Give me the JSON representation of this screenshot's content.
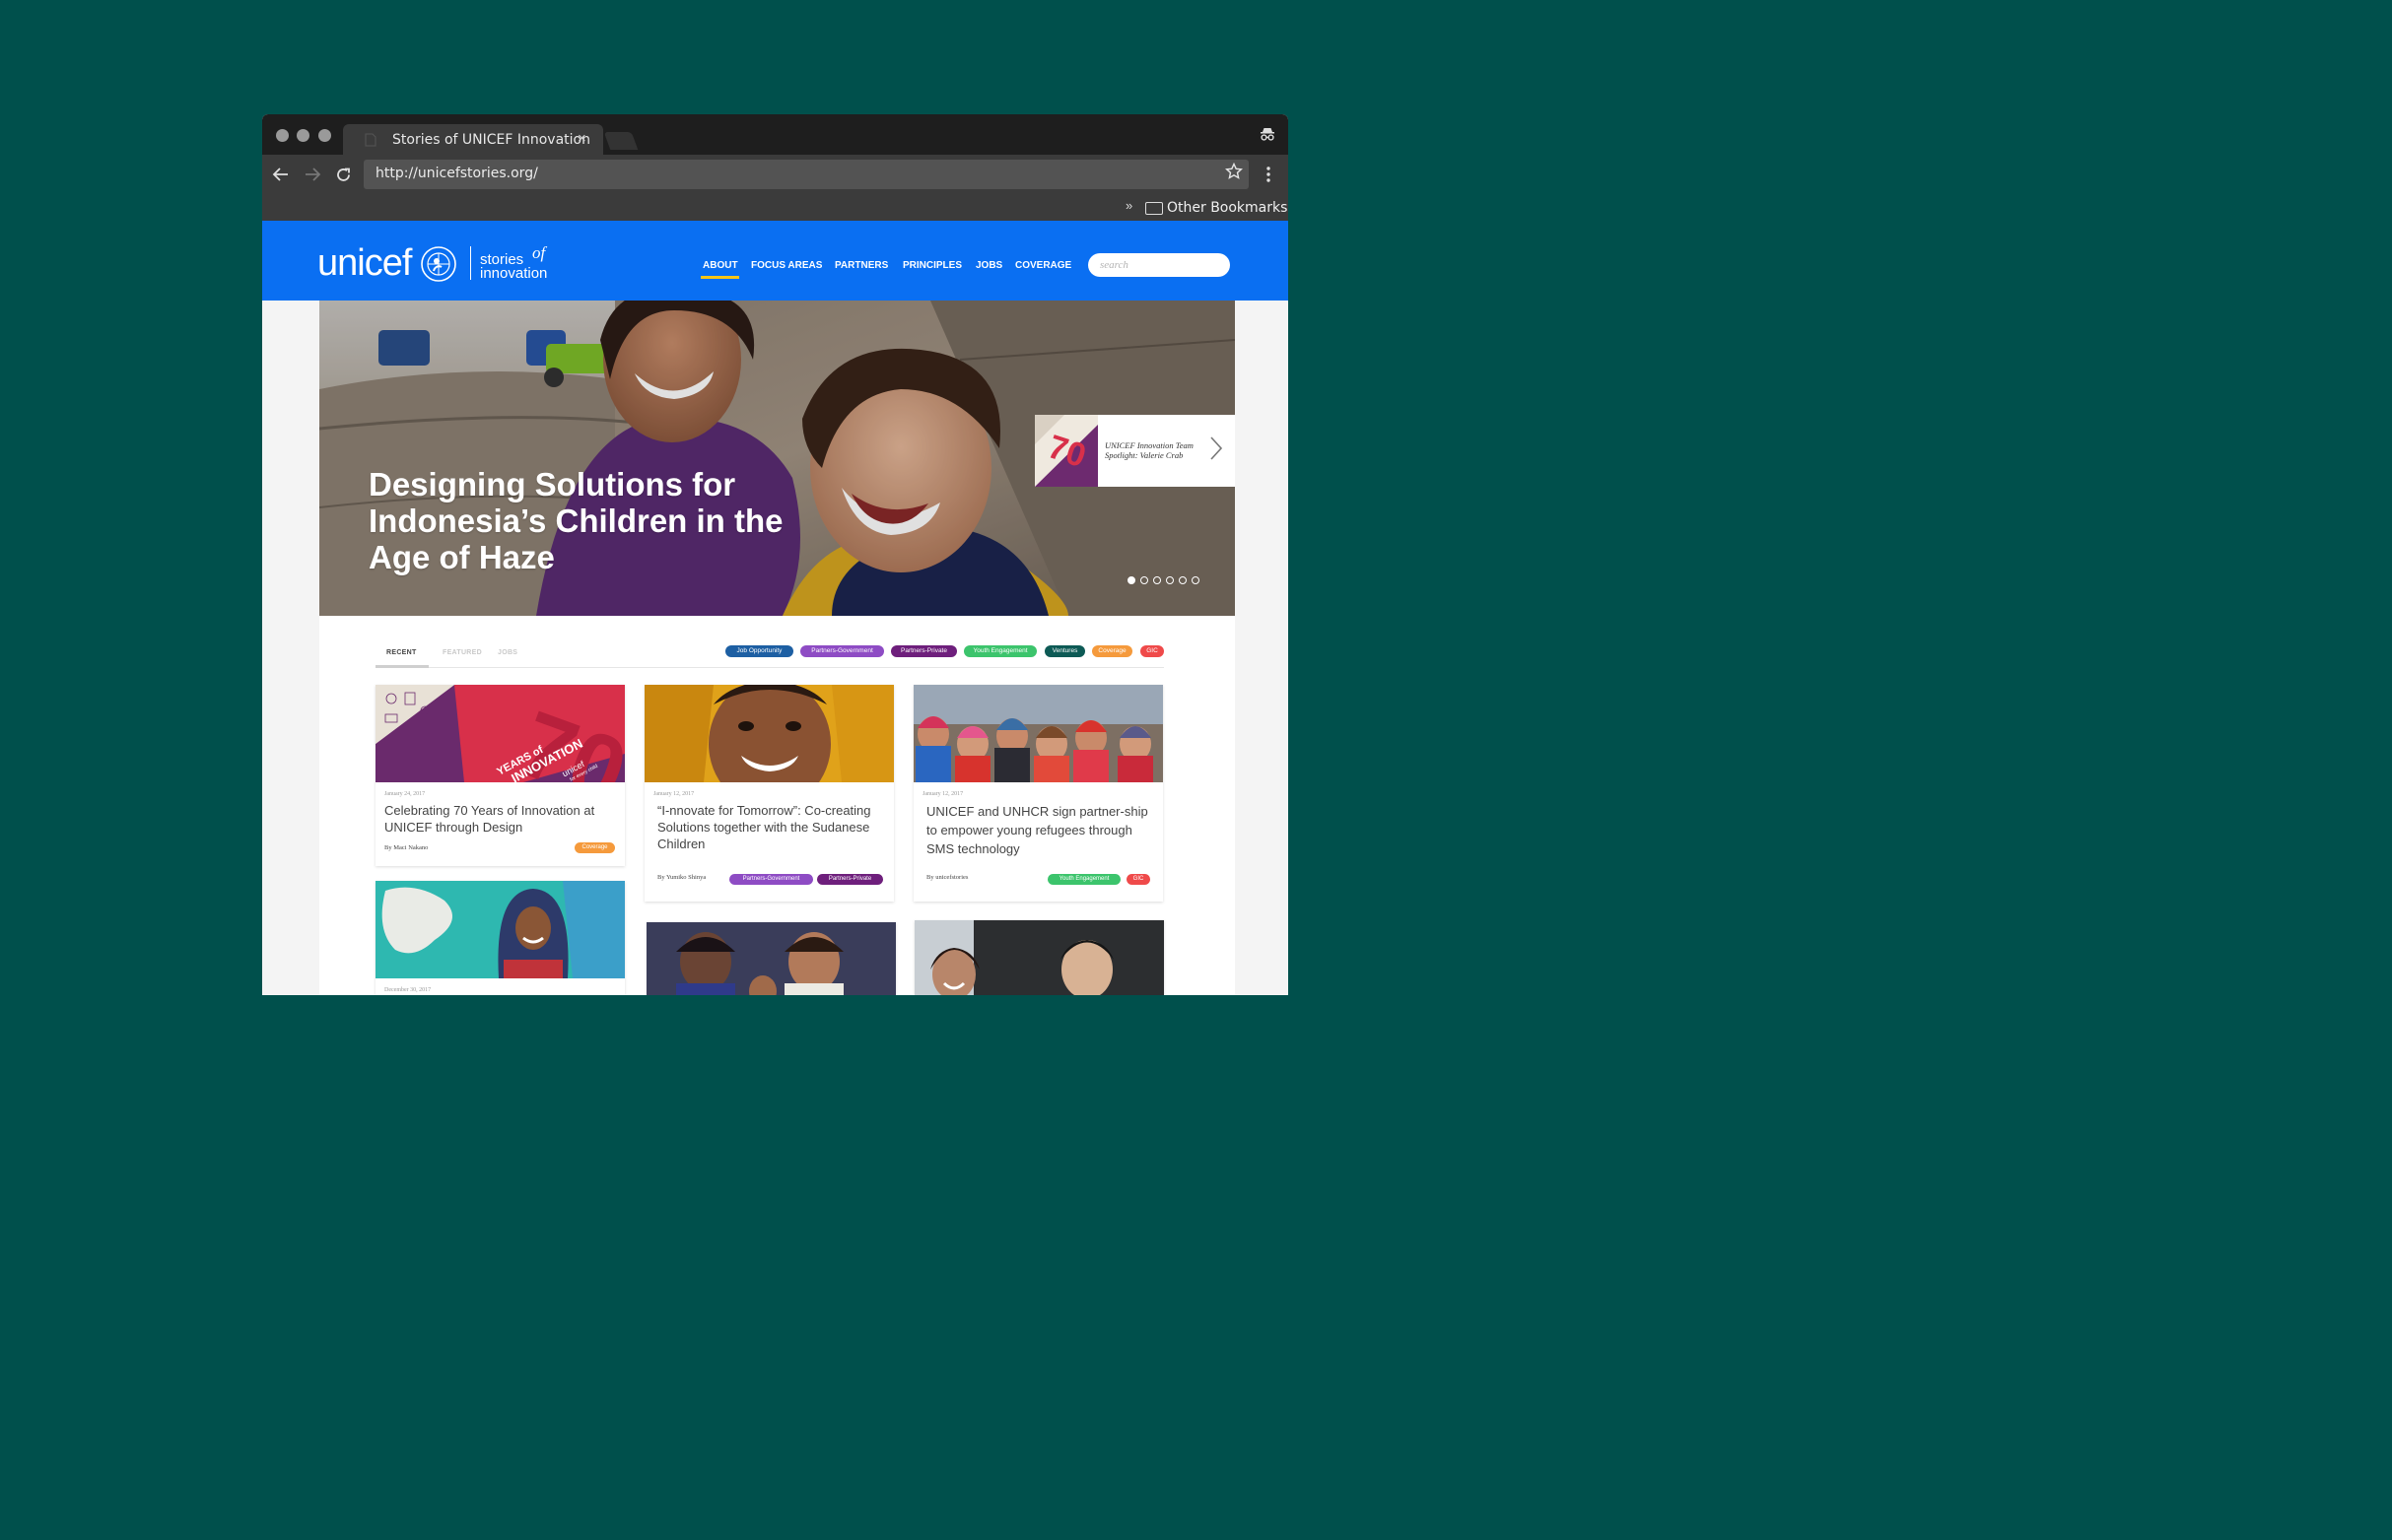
{
  "browser": {
    "tab_title": "Stories of UNICEF Innovation",
    "tab_close": "×",
    "url": "http://unicefstories.org/",
    "bookmarks_chevron": "»",
    "bookmarks_folder": "Other Bookmarks",
    "icons": [
      "back-icon",
      "forward-icon",
      "reload-icon",
      "star-icon",
      "menu-icon",
      "incognito-icon",
      "folder-icon"
    ]
  },
  "site": {
    "logo_word": "unicef",
    "logo_tag_1": "stories",
    "logo_tag_of": "of",
    "logo_tag_2": "innovation",
    "nav": [
      "ABOUT",
      "FOCUS AREAS",
      "PARTNERS",
      "PRINCIPLES",
      "JOBS",
      "COVERAGE"
    ],
    "nav_active": "ABOUT",
    "search_placeholder": "search",
    "brand_color": "#0a6ff2",
    "accent_color": "#f5c518"
  },
  "hero": {
    "title": "Designing Solutions for Indonesia’s Children in the Age of Haze",
    "spotlight_text": "UNICEF Innovation Team Spotlight: Valerie Crab",
    "slide_count": 6,
    "active_slide": 1
  },
  "tabs": {
    "items": [
      "RECENT",
      "FEATURED",
      "JOBS"
    ],
    "active": "RECENT"
  },
  "filters": [
    {
      "label": "Job Opportunity",
      "color": "#1d5fa3"
    },
    {
      "label": "Partners-Government",
      "color": "#8e4cc4"
    },
    {
      "label": "Partners-Private",
      "color": "#6e1f7c"
    },
    {
      "label": "Youth Engagement",
      "color": "#3cc46c"
    },
    {
      "label": "Ventures",
      "color": "#0d5a55"
    },
    {
      "label": "Coverage",
      "color": "#f59a3c"
    },
    {
      "label": "GIC",
      "color": "#ef4a4a"
    }
  ],
  "cards": [
    {
      "date": "January 24, 2017",
      "title": "Celebrating 70 Years of Innovation at UNICEF through Design",
      "author": "By Maci Nakano",
      "tags": [
        {
          "label": "Coverage",
          "color": "#f59a3c"
        }
      ],
      "image_text_1": "YEARS of",
      "image_text_2": "INNOVATION",
      "image_text_3": "unicef",
      "image_text_4": "for every child"
    },
    {
      "date": "January 12, 2017",
      "title": "“I-nnovate for Tomorrow”: Co-creating Solutions together with the Sudanese Children",
      "author": "By Yumiko Shinya",
      "tags": [
        {
          "label": "Partners-Government",
          "color": "#8e4cc4"
        },
        {
          "label": "Partners-Private",
          "color": "#6e1f7c"
        }
      ]
    },
    {
      "date": "January 12, 2017",
      "title": "UNICEF and UNHCR sign partner-ship to empower young refugees through SMS technology",
      "author": "By unicefstories",
      "tags": [
        {
          "label": "Youth Engagement",
          "color": "#3cc46c"
        },
        {
          "label": "GIC",
          "color": "#ef4a4a"
        }
      ]
    },
    {
      "date": "December 30, 2017"
    },
    {},
    {}
  ]
}
